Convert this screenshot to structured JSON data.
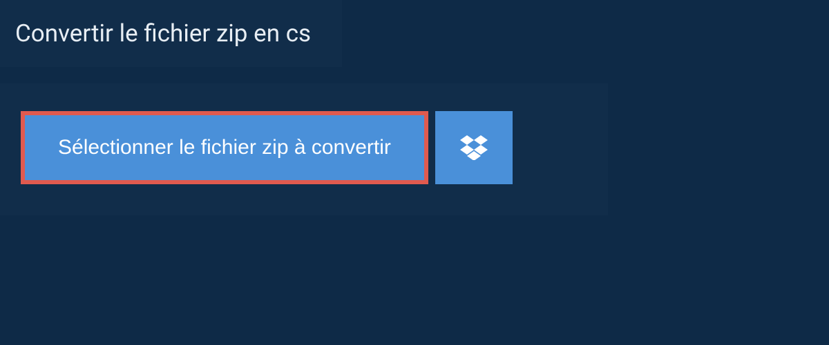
{
  "title": "Convertir le fichier zip en cs",
  "select_button_label": "Sélectionner le fichier zip à convertir",
  "colors": {
    "background": "#0e2a47",
    "panel": "#112d4a",
    "button_primary": "#4a90d9",
    "highlight_border": "#e05a4f",
    "text_light": "#e8eef4",
    "text_white": "#ffffff"
  }
}
